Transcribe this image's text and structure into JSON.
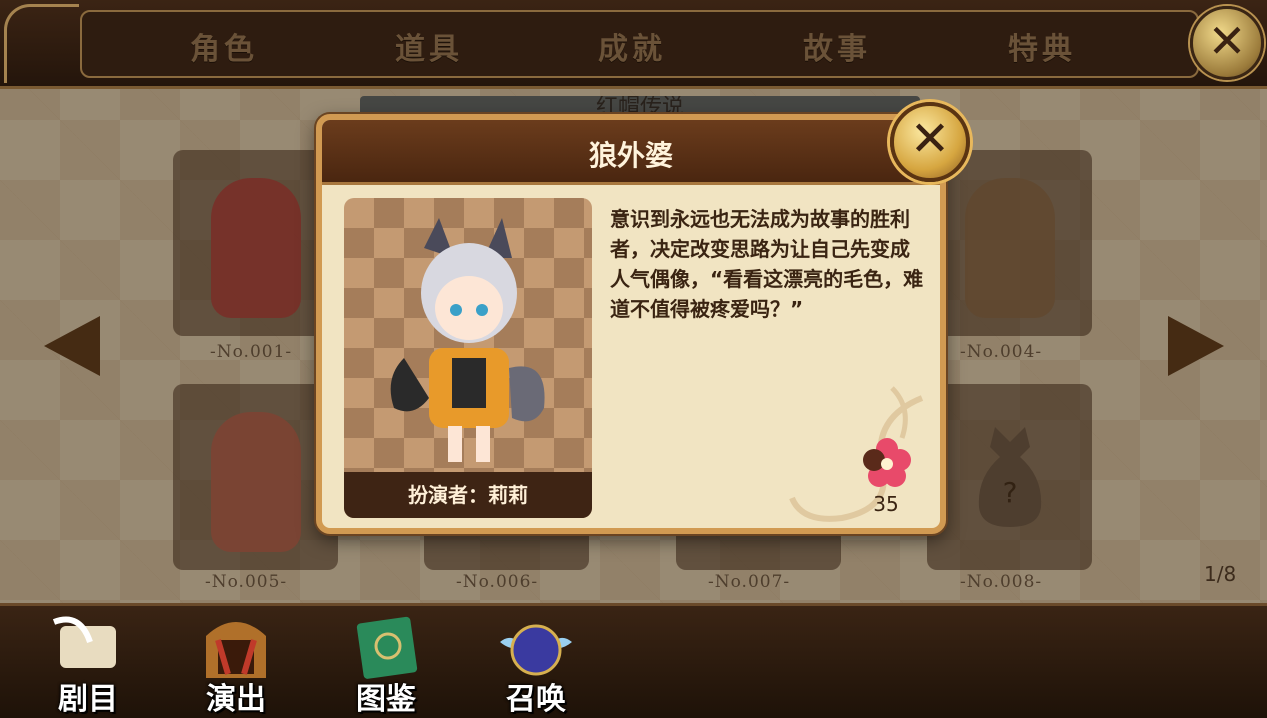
{
  "tabs": [
    {
      "label": "角色"
    },
    {
      "label": "道具"
    },
    {
      "label": "成就"
    },
    {
      "label": "故事"
    },
    {
      "label": "特典"
    }
  ],
  "close_main_label": "✕",
  "section_title": "红帽传说",
  "grid": {
    "numbers": [
      "-No.001-",
      "-No.004-",
      "-No.005-",
      "-No.006-",
      "-No.007-",
      "-No.008-"
    ],
    "page_indicator": "1/8"
  },
  "popup": {
    "title": "狼外婆",
    "close_label": "✕",
    "actor": "扮演者：莉莉",
    "description": "意识到永远也无法成为故事的胜利者，决定改变思路为让自己先变成人气偶像，“看看这漂亮的毛色，难道不值得被疼爱吗？”",
    "affection_value": "35"
  },
  "bottom_nav": [
    {
      "label": "剧目",
      "icon": "scroll-quill-icon"
    },
    {
      "label": "演出",
      "icon": "stage-icon"
    },
    {
      "label": "图鉴",
      "icon": "book-icon"
    },
    {
      "label": "召唤",
      "icon": "summon-orb-icon"
    }
  ],
  "colors": {
    "frame_brown": "#3b2414",
    "popup_border": "#d19a52",
    "popup_bg": "#f1e4c2",
    "gold": "#d6a640",
    "heart_pink": "#e84a6a"
  }
}
